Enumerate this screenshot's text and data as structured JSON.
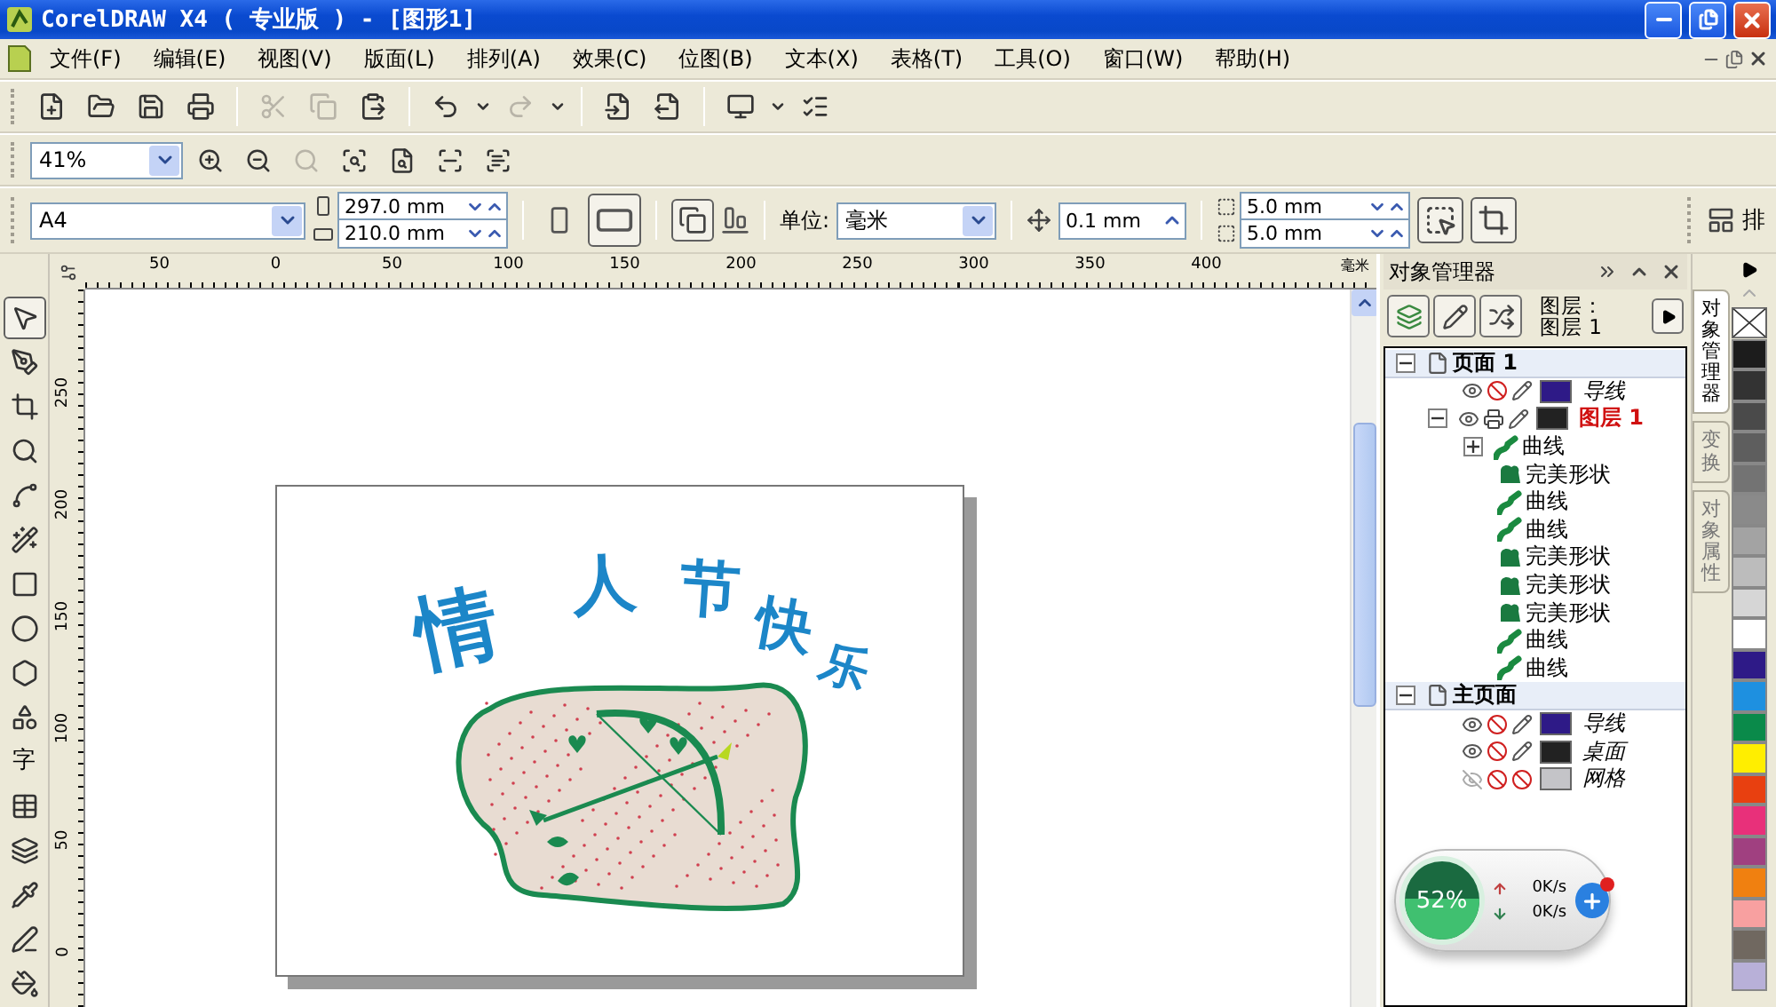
{
  "window": {
    "title": "CorelDRAW X4 ( 专业版 ) - [图形1]"
  },
  "menu": [
    "文件(F)",
    "编辑(E)",
    "视图(V)",
    "版面(L)",
    "排列(A)",
    "效果(C)",
    "位图(B)",
    "文本(X)",
    "表格(T)",
    "工具(O)",
    "窗口(W)",
    "帮助(H)"
  ],
  "standard_toolbar": [
    {
      "kind": "new",
      "disabled": false
    },
    {
      "kind": "open",
      "disabled": false
    },
    {
      "kind": "save",
      "disabled": false
    },
    {
      "kind": "print",
      "disabled": false
    },
    {
      "kind": "cut",
      "disabled": true
    },
    {
      "kind": "copy",
      "disabled": true
    },
    {
      "kind": "paste",
      "disabled": false
    },
    {
      "kind": "undo",
      "disabled": false
    },
    {
      "kind": "redo",
      "disabled": true
    },
    {
      "kind": "import",
      "disabled": false
    },
    {
      "kind": "export",
      "disabled": false
    },
    {
      "kind": "launcher",
      "disabled": false
    },
    {
      "kind": "options",
      "disabled": false
    }
  ],
  "zoom_toolbar": {
    "zoom": "41%",
    "tools": [
      {
        "kind": "in",
        "disabled": false
      },
      {
        "kind": "out",
        "disabled": false
      },
      {
        "kind": "selected",
        "disabled": true
      },
      {
        "kind": "all",
        "disabled": false
      },
      {
        "kind": "page",
        "disabled": false
      },
      {
        "kind": "width",
        "disabled": false
      },
      {
        "kind": "height",
        "disabled": false
      }
    ]
  },
  "property_bar": {
    "paper": "A4",
    "width": "297.0 mm",
    "height": "210.0 mm",
    "orientations": [
      {
        "kind": "portrait",
        "selected": false
      },
      {
        "kind": "landscape",
        "selected": true
      }
    ],
    "units_label": "单位:",
    "units": "毫米",
    "nudge": "0.1 mm",
    "duplicate_x": "5.0 mm",
    "duplicate_y": "5.0 mm",
    "overflow_label": "排"
  },
  "toolbox": [
    {
      "kind": "pick",
      "selected": true
    },
    {
      "kind": "shape",
      "selected": false
    },
    {
      "kind": "crop",
      "selected": false
    },
    {
      "kind": "zoom",
      "selected": false
    },
    {
      "kind": "freehand",
      "selected": false
    },
    {
      "kind": "smart",
      "selected": false
    },
    {
      "kind": "rectangle",
      "selected": false
    },
    {
      "kind": "ellipse",
      "selected": false
    },
    {
      "kind": "polygon",
      "selected": false
    },
    {
      "kind": "shapes",
      "selected": false
    },
    {
      "kind": "text",
      "label": "字",
      "selected": false
    },
    {
      "kind": "table",
      "selected": false
    },
    {
      "kind": "interactive",
      "selected": false
    },
    {
      "kind": "eyedropper",
      "selected": false
    },
    {
      "kind": "outline",
      "selected": false
    },
    {
      "kind": "fill",
      "selected": false
    }
  ],
  "rulers": {
    "horizontal": [
      "50",
      "0",
      "50",
      "100",
      "150",
      "200",
      "250",
      "300",
      "350",
      "400"
    ],
    "unit": "毫米",
    "vertical": [
      "250",
      "200",
      "150",
      "100",
      "50",
      "0"
    ]
  },
  "artwork": {
    "greeting": "情人节快乐"
  },
  "object_manager": {
    "title": "对象管理器",
    "layer_caption": "图层：",
    "current_layer": "图层 1",
    "tree": [
      {
        "label": "页面 1",
        "kind": "page",
        "expanded": true,
        "children": [
          {
            "label": "导线",
            "kind": "layer",
            "active": false,
            "color": "#2e1a87",
            "visible": true,
            "printable": false,
            "editable": true
          },
          {
            "label": "图层 1",
            "kind": "layer",
            "active": true,
            "color": "#222222",
            "visible": true,
            "printable": true,
            "editable": true,
            "expanded": true,
            "children": [
              {
                "label": "曲线",
                "kind": "curve",
                "expanded": false
              },
              {
                "label": "完美形状",
                "kind": "shape"
              },
              {
                "label": "曲线",
                "kind": "curve"
              },
              {
                "label": "曲线",
                "kind": "curve"
              },
              {
                "label": "完美形状",
                "kind": "shape"
              },
              {
                "label": "完美形状",
                "kind": "shape"
              },
              {
                "label": "完美形状",
                "kind": "shape"
              },
              {
                "label": "曲线",
                "kind": "curve"
              },
              {
                "label": "曲线",
                "kind": "curve"
              }
            ]
          }
        ]
      },
      {
        "label": "主页面",
        "kind": "page",
        "expanded": true,
        "children": [
          {
            "label": "导线",
            "kind": "layer",
            "active": false,
            "color": "#2e1a87",
            "visible": true,
            "printable": false,
            "editable": true
          },
          {
            "label": "桌面",
            "kind": "layer",
            "active": false,
            "color": "#222222",
            "visible": true,
            "printable": false,
            "editable": true
          },
          {
            "label": "网格",
            "kind": "layer",
            "active": false,
            "color": "#c4c4c8",
            "visible": false,
            "printable": false,
            "editable": false
          }
        ]
      }
    ]
  },
  "docker_tabs": [
    {
      "label": "对象管理器",
      "selected": true
    },
    {
      "label": "变换",
      "selected": false
    },
    {
      "label": "对象属性",
      "selected": false
    }
  ],
  "palette": [
    {
      "kind": "none"
    },
    {
      "color": "#1c1c1c"
    },
    {
      "color": "#333333"
    },
    {
      "color": "#4a4a4a"
    },
    {
      "color": "#5e5e5e"
    },
    {
      "color": "#737373"
    },
    {
      "color": "#8a8a8a"
    },
    {
      "color": "#a3a3a3"
    },
    {
      "color": "#bcbcbc"
    },
    {
      "color": "#d6d6d6"
    },
    {
      "color": "#ffffff"
    },
    {
      "color": "#2e1a87"
    },
    {
      "color": "#1e90e0"
    },
    {
      "color": "#0a8a4a"
    },
    {
      "color": "#ffee00"
    },
    {
      "color": "#e84010"
    },
    {
      "color": "#e8307a"
    },
    {
      "color": "#a04080"
    },
    {
      "color": "#f08010"
    },
    {
      "color": "#f8a0a0"
    },
    {
      "color": "#706860"
    },
    {
      "color": "#b8b0d8"
    }
  ],
  "network_widget": {
    "level": 0.52,
    "percent": "52%",
    "upload": "0K/s",
    "download": "0K/s"
  }
}
